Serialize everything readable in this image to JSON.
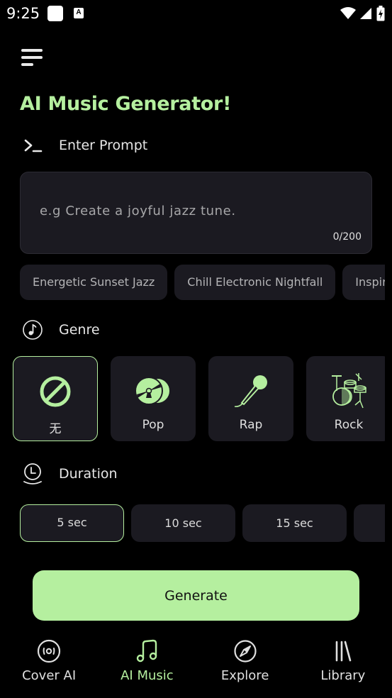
{
  "status_bar": {
    "time": "9:25",
    "notification_icon": "A"
  },
  "header": {
    "menu_icon": "hamburger-menu-icon",
    "title": "AI Music Generator!"
  },
  "prompt": {
    "section_label": "Enter Prompt",
    "section_icon": "terminal-prompt-icon",
    "placeholder": "e.g Create a joyful jazz tune.",
    "value": "",
    "char_count": "0/200",
    "suggestions": [
      "Energetic Sunset Jazz",
      "Chill Electronic Nightfall",
      "Inspiring"
    ]
  },
  "genre": {
    "section_label": "Genre",
    "section_icon": "music-note-circle-icon",
    "items": [
      {
        "label": "无",
        "icon": "none-icon",
        "selected": true
      },
      {
        "label": "Pop",
        "icon": "vinyl-disc-icon",
        "selected": false
      },
      {
        "label": "Rap",
        "icon": "microphone-icon",
        "selected": false
      },
      {
        "label": "Rock",
        "icon": "drum-kit-icon",
        "selected": false
      }
    ]
  },
  "duration": {
    "section_label": "Duration",
    "section_icon": "clock-icon",
    "options": [
      {
        "label": "5 sec",
        "selected": true
      },
      {
        "label": "10 sec",
        "selected": false
      },
      {
        "label": "15 sec",
        "selected": false
      },
      {
        "label": "",
        "selected": false
      }
    ]
  },
  "actions": {
    "generate_label": "Generate"
  },
  "bottom_nav": {
    "items": [
      {
        "label": "Cover AI",
        "icon": "disc-icon",
        "active": false
      },
      {
        "label": "AI Music",
        "icon": "music-note-icon",
        "active": true
      },
      {
        "label": "Explore",
        "icon": "compass-icon",
        "active": false
      },
      {
        "label": "Library",
        "icon": "library-icon",
        "active": false
      }
    ]
  },
  "colors": {
    "accent": "#b5ef9f",
    "background": "#000000",
    "card": "#1b1a21",
    "text": "#e6e6e6"
  }
}
